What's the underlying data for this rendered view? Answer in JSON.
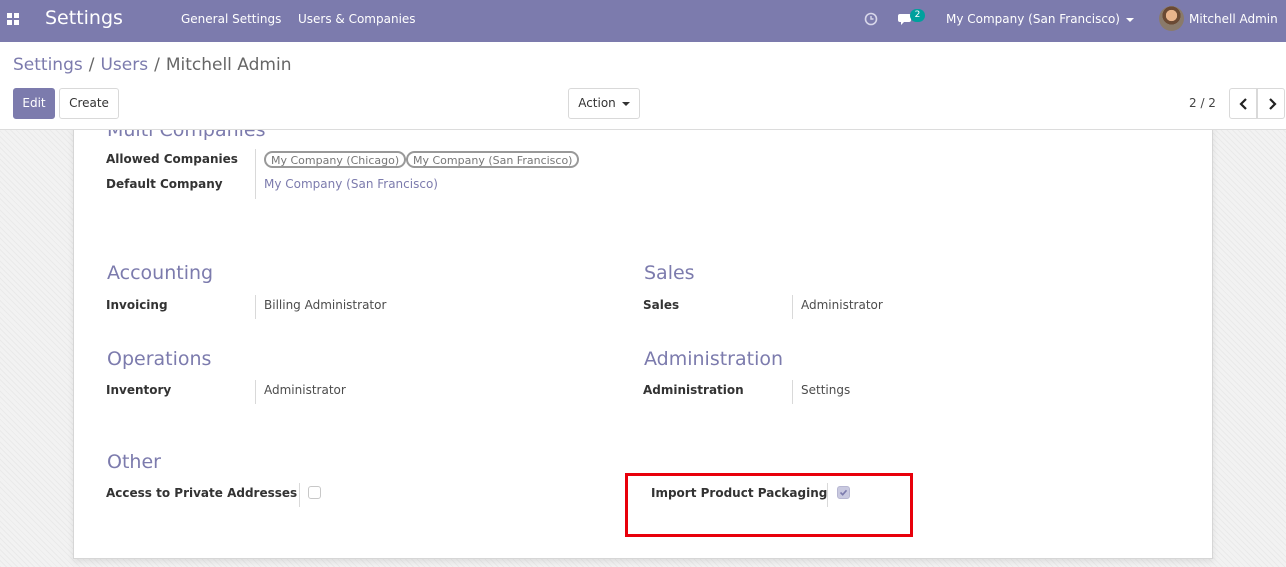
{
  "navbar": {
    "app_title": "Settings",
    "menus": [
      "General Settings",
      "Users & Companies"
    ],
    "messages_badge": "2",
    "company_switcher": "My Company (San Francisco)",
    "user_name": "Mitchell Admin",
    "color": "#7c7bad"
  },
  "breadcrumb": {
    "items": [
      "Settings",
      "Users"
    ],
    "current": "Mitchell Admin"
  },
  "buttons": {
    "edit": "Edit",
    "create": "Create",
    "action": "Action"
  },
  "pager": {
    "value": "2 / 2"
  },
  "form": {
    "multi_companies": {
      "title": "Multi Companies",
      "allowed_companies_label": "Allowed Companies",
      "allowed_companies": [
        "My Company (Chicago)",
        "My Company (San Francisco)"
      ],
      "default_company_label": "Default Company",
      "default_company": "My Company (San Francisco)"
    },
    "accounting": {
      "title": "Accounting",
      "label": "Invoicing",
      "value": "Billing Administrator"
    },
    "sales": {
      "title": "Sales",
      "label": "Sales",
      "value": "Administrator"
    },
    "operations": {
      "title": "Operations",
      "label": "Inventory",
      "value": "Administrator"
    },
    "administration": {
      "title": "Administration",
      "label": "Administration",
      "value": "Settings"
    },
    "other": {
      "title": "Other",
      "private_addresses_label": "Access to Private Addresses",
      "private_addresses_checked": false,
      "import_packaging_label": "Import Product Packaging",
      "import_packaging_checked": true
    }
  },
  "colors": {
    "accent": "#7c7bad",
    "badge": "#00a09d",
    "highlight": "#e8000b"
  }
}
